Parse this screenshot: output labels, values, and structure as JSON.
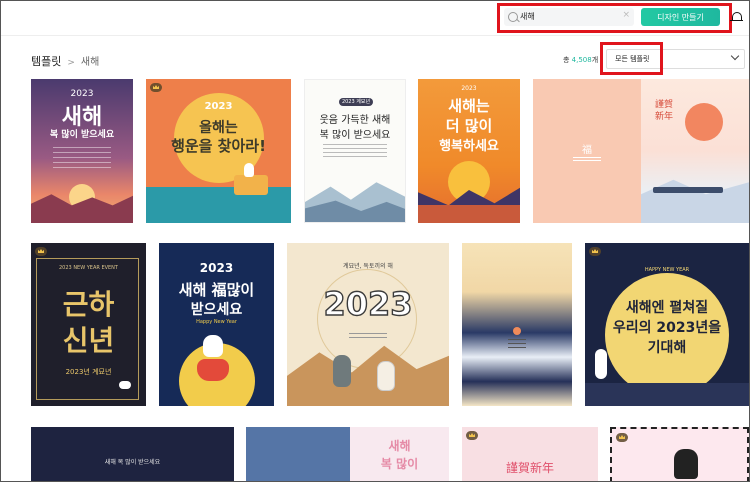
{
  "header": {
    "search_query": "새해",
    "clear_glyph": "×",
    "make_design_label": "디자인 만들기"
  },
  "breadcrumb": {
    "root": "템플릿",
    "separator": ">",
    "current": "새해"
  },
  "result_count": {
    "prefix": "총 ",
    "number": "4,508",
    "suffix": "개"
  },
  "filter": {
    "selected": "모든 템플릿"
  },
  "cards": {
    "c1": {
      "year": "2023",
      "main": "새해",
      "sub": "복 많이 받으세요"
    },
    "c2": {
      "year": "2023",
      "line1": "올해는",
      "line2": "행운을 찾아라!"
    },
    "c3": {
      "badge": "2023 계묘년",
      "line1": "웃음 가득한 새해",
      "line2": "복 많이 받으세요"
    },
    "c4": {
      "year": "2023",
      "line1": "새해는",
      "line2": "더 많이",
      "line3": "행복하세요"
    },
    "c5": {
      "mark": "福"
    },
    "c6": {
      "line1": "謹賀",
      "line2": "新年"
    },
    "c7": {
      "event": "2023 NEW YEAR EVENT",
      "main1": "근하",
      "main2": "신년",
      "bottom": "2023년 계묘년"
    },
    "c8": {
      "year": "2023",
      "line1": "새해 福많이",
      "line2": "받으세요",
      "sub": "Happy New Year"
    },
    "c9": {
      "header": "계묘년, 독토끼의 해",
      "year": "2023"
    },
    "c11": {
      "sub": "HAPPY NEW YEAR",
      "line1": "새해엔 펼쳐질",
      "line2": "우리의 2023년을",
      "line3": "기대해"
    },
    "c12": {
      "text": "새해 복 많이 받으세요"
    },
    "c14": {
      "line1": "새해",
      "line2": "복 많이"
    },
    "c15": {
      "text": "謹賀新年"
    }
  }
}
